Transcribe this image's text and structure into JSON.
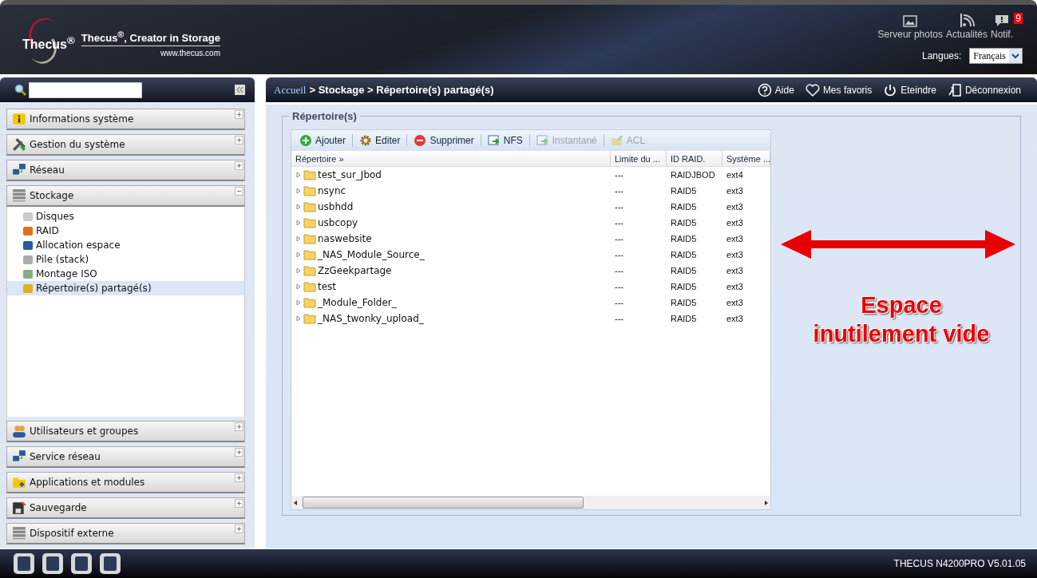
{
  "header": {
    "logo": "Thecus$^{®}$",
    "tagline": "Thecus$^{®}$, Creator in Storage",
    "url": "www.thecus.com",
    "shortcuts": [
      {
        "label": "Serveur photos",
        "kind": "photo"
      },
      {
        "label": "Actualités",
        "kind": "rss"
      },
      {
        "label": "Notif.",
        "kind": "notif",
        "badge": "9"
      }
    ],
    "language_label": "Langues:",
    "language_value": "Français"
  },
  "sidebar": {
    "sections": [
      {
        "label": "Informations système",
        "expanded": false
      },
      {
        "label": "Gestion du système",
        "expanded": false
      },
      {
        "label": "Réseau",
        "expanded": false
      },
      {
        "label": "Stockage",
        "expanded": true,
        "children": [
          {
            "label": "Disques",
            "selected": false
          },
          {
            "label": "RAID",
            "selected": false
          },
          {
            "label": "Allocation espace",
            "selected": false
          },
          {
            "label": "Pile (stack)",
            "selected": false
          },
          {
            "label": "Montage ISO",
            "selected": false
          },
          {
            "label": "Répertoire(s) partagé(s)",
            "selected": true
          }
        ]
      },
      {
        "label": "Utilisateurs et groupes",
        "expanded": false
      },
      {
        "label": "Service réseau",
        "expanded": false
      },
      {
        "label": "Applications et modules",
        "expanded": false
      },
      {
        "label": "Sauvegarde",
        "expanded": false
      },
      {
        "label": "Dispositif externe",
        "expanded": false
      }
    ]
  },
  "breadcrumb": {
    "home": "Accueil",
    "path": "> Stockage > Répertoire(s) partagé(s)"
  },
  "top_actions": [
    {
      "label": "Aide",
      "kind": "help"
    },
    {
      "label": "Mes favoris",
      "kind": "favorites"
    },
    {
      "label": "Eteindre",
      "kind": "power"
    },
    {
      "label": "Déconnexion",
      "kind": "logout"
    }
  ],
  "panel": {
    "title": "Répertoire(s)",
    "toolbar": [
      {
        "label": "Ajouter",
        "kind": "add",
        "disabled": false
      },
      {
        "label": "Editer",
        "kind": "edit",
        "disabled": false
      },
      {
        "label": "Supprimer",
        "kind": "delete",
        "disabled": false
      },
      {
        "label": "NFS",
        "kind": "nfs",
        "disabled": false
      },
      {
        "label": "Instantané",
        "kind": "snapshot",
        "disabled": true
      },
      {
        "label": "ACL",
        "kind": "acl",
        "disabled": true
      }
    ],
    "columns": [
      "Répertoire »",
      "Limite du ...",
      "ID RAID.",
      "Système ..."
    ],
    "rows": [
      {
        "name": "test_sur_Jbod",
        "limit": "---",
        "raid": "RAIDJBOD",
        "fs": "ext4"
      },
      {
        "name": "nsync",
        "limit": "---",
        "raid": "RAID5",
        "fs": "ext3"
      },
      {
        "name": "usbhdd",
        "limit": "---",
        "raid": "RAID5",
        "fs": "ext3"
      },
      {
        "name": "usbcopy",
        "limit": "---",
        "raid": "RAID5",
        "fs": "ext3"
      },
      {
        "name": "naswebsite",
        "limit": "---",
        "raid": "RAID5",
        "fs": "ext3"
      },
      {
        "name": "_NAS_Module_Source_",
        "limit": "---",
        "raid": "RAID5",
        "fs": "ext3"
      },
      {
        "name": "ZzGeekpartage",
        "limit": "---",
        "raid": "RAID5",
        "fs": "ext3"
      },
      {
        "name": "test",
        "limit": "---",
        "raid": "RAID5",
        "fs": "ext3"
      },
      {
        "name": "_Module_Folder_",
        "limit": "---",
        "raid": "RAID5",
        "fs": "ext3"
      },
      {
        "name": "_NAS_twonky_upload_",
        "limit": "---",
        "raid": "RAID5",
        "fs": "ext3"
      }
    ]
  },
  "annotation": {
    "lines": [
      "Espace",
      "inutilement vide"
    ]
  },
  "footer": {
    "version": "THECUS N4200PRO V5.01.05"
  }
}
